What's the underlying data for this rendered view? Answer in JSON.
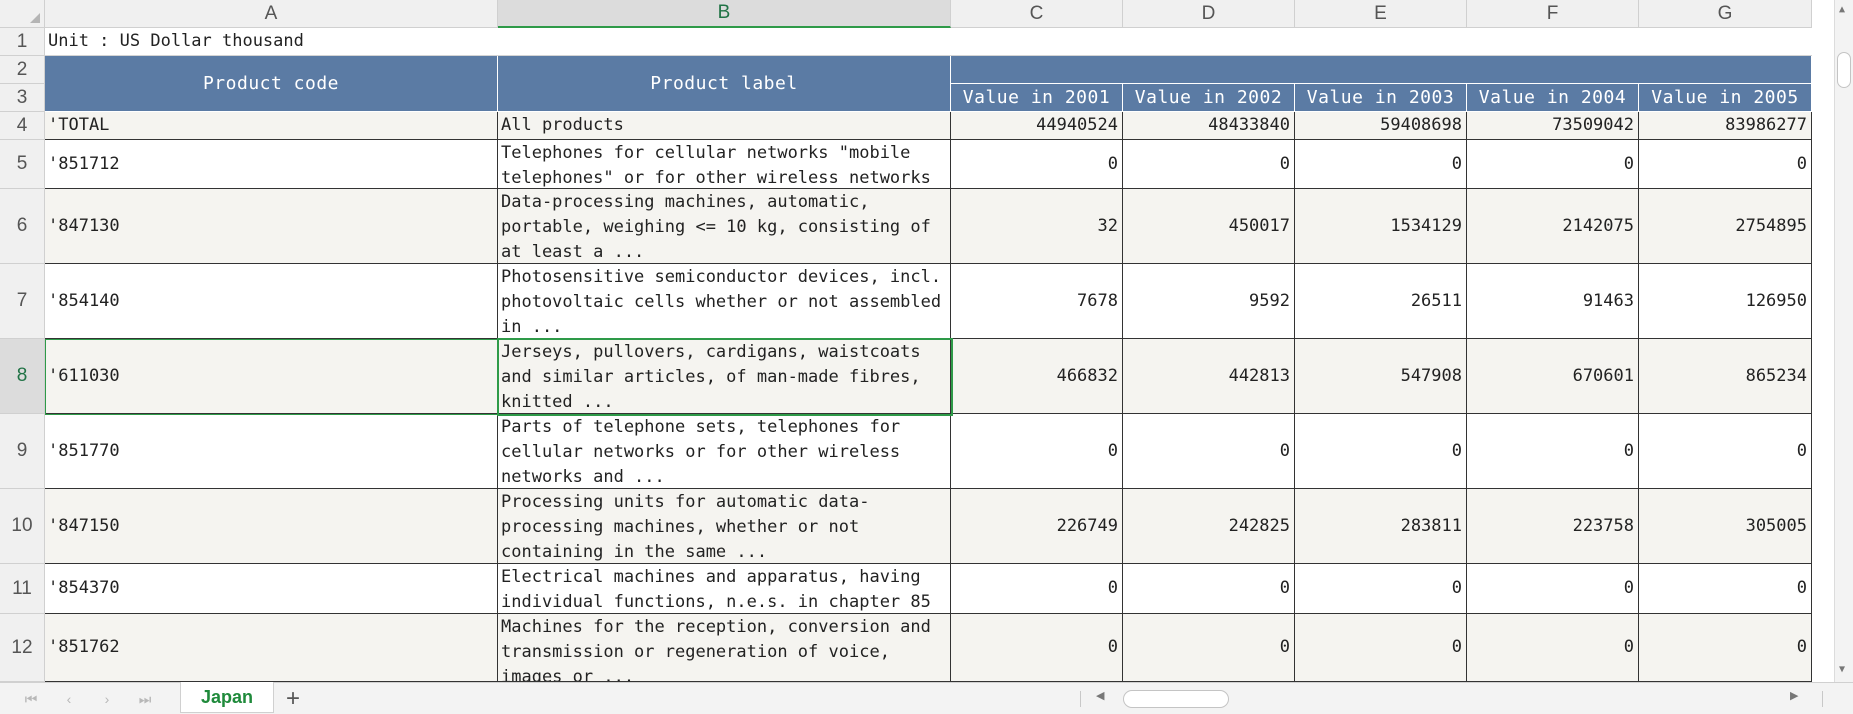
{
  "columns": [
    "A",
    "B",
    "C",
    "D",
    "E",
    "F",
    "G"
  ],
  "row_numbers": [
    "1",
    "2",
    "3",
    "4",
    "5",
    "6",
    "7",
    "8",
    "9",
    "10",
    "11",
    "12"
  ],
  "unit_label": "Unit : US Dollar thousand",
  "headers": {
    "product_code": "Product code",
    "product_label": "Product label",
    "values": [
      "Value in 2001",
      "Value in 2002",
      "Value in 2003",
      "Value in 2004",
      "Value in 2005"
    ]
  },
  "rows": [
    {
      "code": "'TOTAL",
      "label": "All products",
      "values": [
        "44940524",
        "48433840",
        "59408698",
        "73509042",
        "83986277"
      ]
    },
    {
      "code": "'851712",
      "label": "Telephones for cellular networks \"mobile telephones\" or for other wireless networks",
      "values": [
        "0",
        "0",
        "0",
        "0",
        "0"
      ]
    },
    {
      "code": "'847130",
      "label": "Data-processing machines, automatic, portable, weighing <= 10 kg, consisting of at least a ...",
      "values": [
        "32",
        "450017",
        "1534129",
        "2142075",
        "2754895"
      ]
    },
    {
      "code": "'854140",
      "label": "Photosensitive semiconductor devices, incl. photovoltaic cells whether or not assembled in ...",
      "values": [
        "7678",
        "9592",
        "26511",
        "91463",
        "126950"
      ]
    },
    {
      "code": "'611030",
      "label": "Jerseys, pullovers, cardigans, waistcoats and similar articles, of man-made fibres, knitted ...",
      "values": [
        "466832",
        "442813",
        "547908",
        "670601",
        "865234"
      ]
    },
    {
      "code": "'851770",
      "label": "Parts of telephone sets, telephones for cellular networks or for other wireless networks and ...",
      "values": [
        "0",
        "0",
        "0",
        "0",
        "0"
      ]
    },
    {
      "code": "'847150",
      "label": "Processing units for automatic data-processing machines, whether or not containing in the same ...",
      "values": [
        "226749",
        "242825",
        "283811",
        "223758",
        "305005"
      ]
    },
    {
      "code": "'854370",
      "label": "Electrical machines and apparatus, having individual functions, n.e.s. in chapter 85",
      "values": [
        "0",
        "0",
        "0",
        "0",
        "0"
      ]
    },
    {
      "code": "'851762",
      "label": "Machines for the reception, conversion and transmission or regeneration of voice, images or ...",
      "values": [
        "0",
        "0",
        "0",
        "0",
        "0"
      ]
    }
  ],
  "selected": {
    "column": "B",
    "row": "8"
  },
  "sheet_tab": "Japan",
  "nav_icons": [
    "first-sheet-icon",
    "prev-sheet-icon",
    "next-sheet-icon",
    "last-sheet-icon"
  ],
  "colors": {
    "header_fill": "#5b7ba4",
    "selection": "#2e9a48",
    "alt_row": "#f5f4f0"
  }
}
